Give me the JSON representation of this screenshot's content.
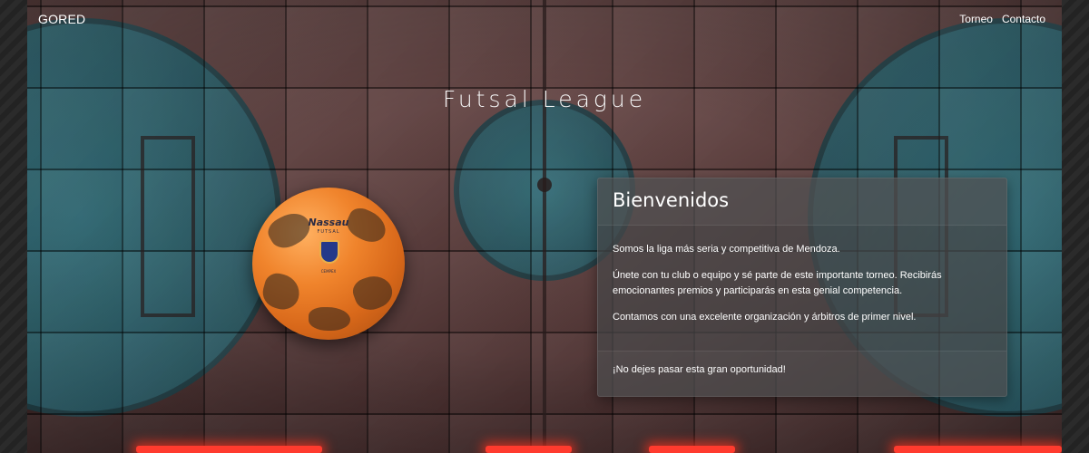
{
  "navbar": {
    "brand": "GORED",
    "links": [
      {
        "label": "Torneo"
      },
      {
        "label": "Contacto"
      }
    ]
  },
  "hero": {
    "title": "Futsal League"
  },
  "ball": {
    "brand_text": "Nassau",
    "sub_text": "FUTSAL",
    "crest_text": "CEMPEX"
  },
  "card": {
    "title": "Bienvenidos",
    "paragraphs": [
      "Somos la liga más seria y competitiva de Mendoza.",
      "Únete con tu club o equipo y sé parte de este importante torneo. Recibirás emocionantes premios y participarás en esta genial competencia.",
      "Contamos con una excelente organización y árbitros de primer nivel."
    ],
    "footer": "¡No dejes pasar esta gran oportunidad!"
  },
  "colors": {
    "accent_glow": "#ff3b2e",
    "court_teal": "#2f7480",
    "court_brown": "#6a4a49",
    "ball_orange": "#f0842c"
  }
}
